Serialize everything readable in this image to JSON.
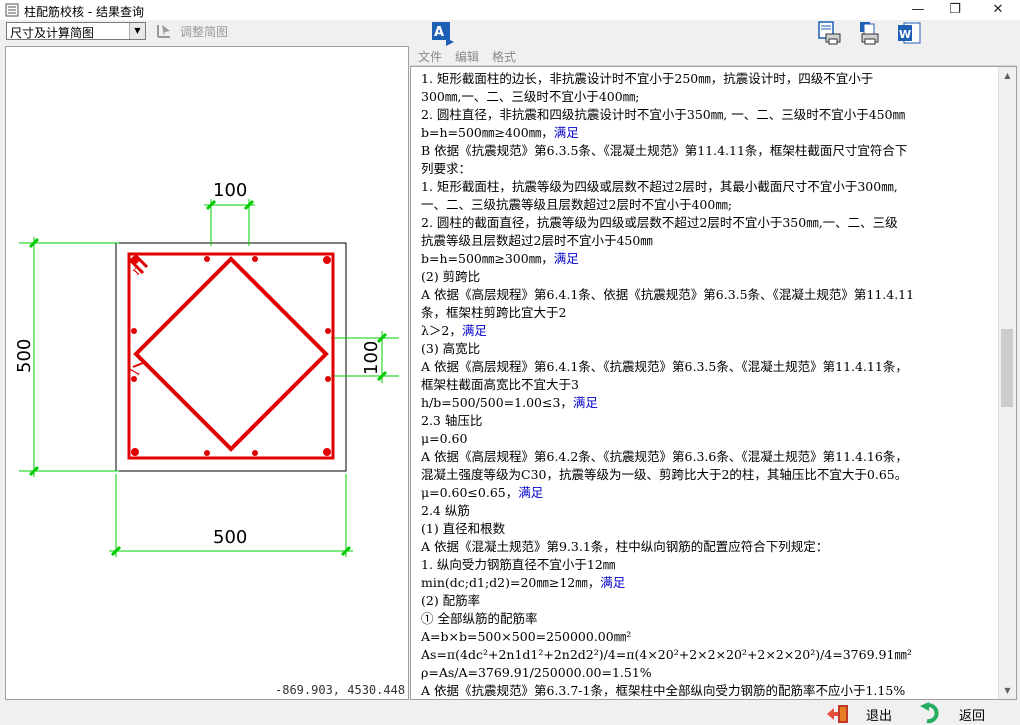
{
  "window": {
    "title": "柱配筋校核 - 结果查询",
    "controls": {
      "minimize": "—",
      "restore": "❐",
      "close": "✕"
    }
  },
  "toolbar": {
    "view_select_value": "尺寸及计算简图",
    "adjust_label": "调整简图"
  },
  "drawing": {
    "dim_top": "100",
    "dim_left": "500",
    "dim_right": "100",
    "dim_bottom": "500",
    "mark1": "π",
    "mark2": "l",
    "rebar_color": "#e00000",
    "dim_color": "#00cc00"
  },
  "status": {
    "coordinates": "-869.903, 4530.448"
  },
  "menu": {
    "file": "文件",
    "edit": "编辑",
    "format": "格式"
  },
  "report": {
    "lines": [
      {
        "text": "      1. 矩形截面柱的边长，非抗震设计时不宜小于250㎜，抗震设计时，四级不宜小于",
        "ok": ""
      },
      {
        "text": "300㎜,一、二、三级时不宜小于400㎜;",
        "ok": ""
      },
      {
        "text": "      2. 圆柱直径，非抗震和四级抗震设计时不宜小于350㎜, 一、二、三级时不宜小于450㎜",
        "ok": ""
      },
      {
        "text": "      b=h=500㎜≥400㎜，",
        "ok": "满足"
      },
      {
        "text": "   B 依据《抗震规范》第6.3.5条、《混凝土规范》第11.4.11条，框架柱截面尺寸宜符合下",
        "ok": ""
      },
      {
        "text": "列要求：",
        "ok": ""
      },
      {
        "text": "      1. 矩形截面柱，抗震等级为四级或层数不超过2层时，其最小截面尺寸不宜小于300㎜,",
        "ok": ""
      },
      {
        "text": "一、二、三级抗震等级且层数超过2层时不宜小于400㎜;",
        "ok": ""
      },
      {
        "text": "      2. 圆柱的截面直径，抗震等级为四级或层数不超过2层时不宜小于350㎜,一、二、三级",
        "ok": ""
      },
      {
        "text": "抗震等级且层数超过2层时不宜小于450㎜",
        "ok": ""
      },
      {
        "text": "      b=h=500㎜≥300㎜，",
        "ok": "满足"
      },
      {
        "text": " (2) 剪跨比",
        "ok": ""
      },
      {
        "text": "   A 依据《高层规程》第6.4.1条、依据《抗震规范》第6.3.5条、《混凝土规范》第11.4.11",
        "ok": ""
      },
      {
        "text": "条，框架柱剪跨比宜大于2",
        "ok": ""
      },
      {
        "text": "      λ＞2，",
        "ok": "满足"
      },
      {
        "text": " (3) 高宽比",
        "ok": ""
      },
      {
        "text": "   A 依据《高层规程》第6.4.1条、《抗震规范》第6.3.5条、《混凝土规范》第11.4.11条，",
        "ok": ""
      },
      {
        "text": "框架柱截面高宽比不宜大于3",
        "ok": ""
      },
      {
        "text": "      h/b=500/500=1.00≤3，",
        "ok": "满足"
      },
      {
        "text": " 2.3 轴压比",
        "ok": ""
      },
      {
        "text": "      μ=0.60",
        "ok": ""
      },
      {
        "text": "   A 依据《高层规程》第6.4.2条、《抗震规范》第6.3.6条、《混凝土规范》第11.4.16条，",
        "ok": ""
      },
      {
        "text": "混凝土强度等级为C30，抗震等级为一级、剪跨比大于2的柱，其轴压比不宜大于0.65。",
        "ok": ""
      },
      {
        "text": "      μ=0.60≤0.65，",
        "ok": "满足"
      },
      {
        "text": " 2.4 纵筋",
        "ok": ""
      },
      {
        "text": " (1) 直径和根数",
        "ok": ""
      },
      {
        "text": "   A 依据《混凝土规范》第9.3.1条，柱中纵向钢筋的配置应符合下列规定：",
        "ok": ""
      },
      {
        "text": "      1. 纵向受力钢筋直径不宜小于12㎜",
        "ok": ""
      },
      {
        "text": "      min(dc;d1;d2)=20㎜≥12㎜，",
        "ok": "满足"
      },
      {
        "text": " (2) 配筋率",
        "ok": ""
      },
      {
        "text": "  ① 全部纵筋的配筋率",
        "ok": ""
      },
      {
        "text": "      A=b×b=500×500=250000.00㎜²",
        "ok": ""
      },
      {
        "text": "      As=π(4dc²+2n1d1²+2n2d2²)/4=π(4×20²+2×2×20²+2×2×20²)/4=3769.91㎜²",
        "ok": ""
      },
      {
        "text": "      ρ=As/A=3769.91/250000.00=1.51%",
        "ok": ""
      },
      {
        "text": "   A 依据《抗震规范》第6.3.7-1条，框架柱中全部纵向受力钢筋的配筋率不应小于1.15%",
        "ok": ""
      }
    ]
  },
  "bottom": {
    "exit_label": "退出",
    "back_label": "返回"
  }
}
